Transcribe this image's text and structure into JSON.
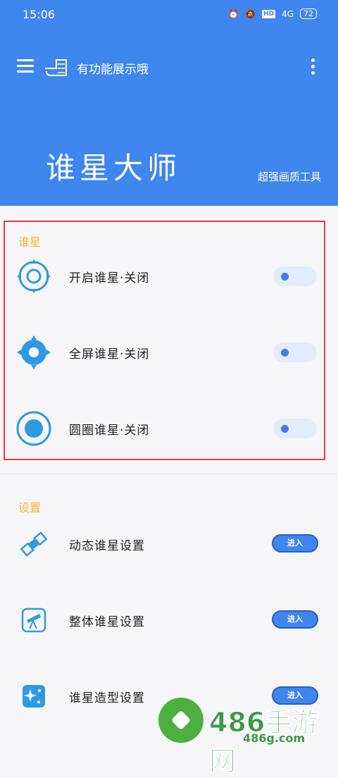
{
  "status_bar": {
    "time": "15:06",
    "network": "4G",
    "battery": "72"
  },
  "app_bar": {
    "title": "有功能展示哦"
  },
  "hero": {
    "title": "谁星大师",
    "subtitle": "超强画质工具"
  },
  "section_crosshair": {
    "title": "谁星",
    "items": [
      {
        "label": "开启谁星·关闭",
        "icon": "target-ring-icon"
      },
      {
        "label": "全屏谁星·关闭",
        "icon": "target-dot-icon"
      },
      {
        "label": "圆圈谁星·关闭",
        "icon": "circle-dot-icon"
      }
    ]
  },
  "section_settings": {
    "title": "设置",
    "items": [
      {
        "label": "动态谁星设置",
        "button": "进入",
        "icon": "satellite-icon"
      },
      {
        "label": "整体谁星设置",
        "button": "进入",
        "icon": "telescope-icon"
      },
      {
        "label": "谁星造型设置",
        "button": "进入",
        "icon": "sparkle-icon"
      }
    ]
  },
  "watermark": {
    "brand": "486手游网",
    "url": "486g.com"
  },
  "colors": {
    "primary": "#3f86ee",
    "section_title": "#efb833",
    "highlight_box": "#e33a44"
  }
}
